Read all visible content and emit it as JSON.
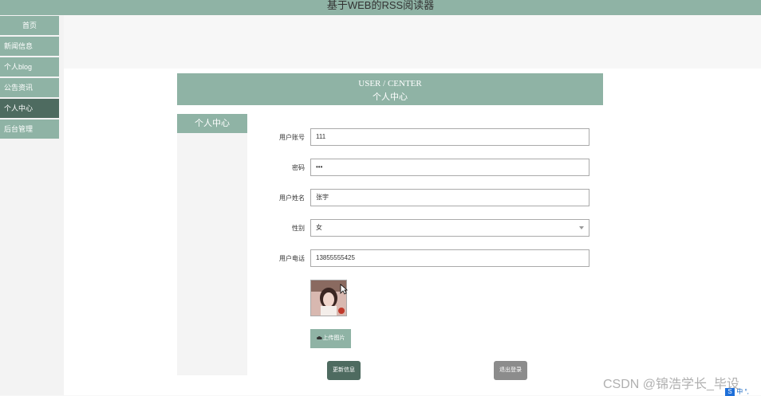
{
  "app": {
    "title": "基于WEB的RSS阅读器"
  },
  "sidebar": {
    "items": [
      {
        "label": "首页"
      },
      {
        "label": "新闻信息"
      },
      {
        "label": "个人blog"
      },
      {
        "label": "公告资讯"
      },
      {
        "label": "个人中心"
      },
      {
        "label": "后台管理"
      }
    ],
    "active_index": 4
  },
  "banner": {
    "en_title": "USER / CENTER",
    "cn_title": "个人中心"
  },
  "left_panel": {
    "title": "个人中心"
  },
  "form": {
    "account": {
      "label": "用户账号",
      "value": "111"
    },
    "password": {
      "label": "密码",
      "value": "•••"
    },
    "name": {
      "label": "用户姓名",
      "value": "张宇"
    },
    "gender": {
      "label": "性别",
      "value": "女"
    },
    "phone": {
      "label": "用户电话",
      "value": "13855555425"
    },
    "upload_label": "上传图片",
    "update_label": "更新信息",
    "logout_label": "退出登录"
  },
  "watermark": {
    "text": "CSDN @锦浩学长_毕设"
  },
  "ime": {
    "badge": "S",
    "text": "中 °,"
  },
  "colors": {
    "primary": "#8fb3a5",
    "dark": "#4e6b60",
    "gray_button": "#8c8c8c"
  },
  "icons": {
    "upload": "cloud-upload-icon",
    "chevron": "chevron-down-icon",
    "cursor": "mouse-cursor-icon"
  }
}
